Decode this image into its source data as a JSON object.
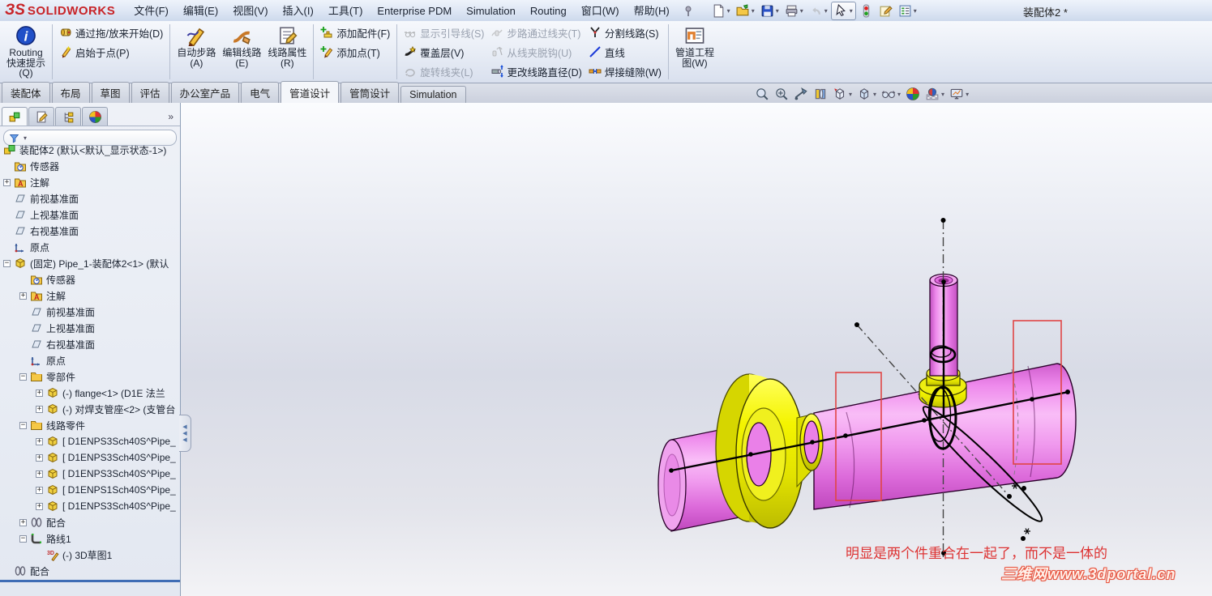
{
  "window": {
    "doc_title": "装配体2 *"
  },
  "logo": {
    "mark": "ЗS",
    "name": "SOLIDWORKS"
  },
  "menus": [
    "文件(F)",
    "编辑(E)",
    "视图(V)",
    "插入(I)",
    "工具(T)",
    "Enterprise PDM",
    "Simulation",
    "Routing",
    "窗口(W)",
    "帮助(H)"
  ],
  "quickbar": [
    {
      "icon": "new-document",
      "dropdown": true
    },
    {
      "icon": "open",
      "dropdown": true
    },
    {
      "icon": "save",
      "dropdown": true
    },
    {
      "icon": "print",
      "dropdown": true
    },
    {
      "icon": "undo",
      "dropdown": true,
      "disabled": true
    },
    {
      "icon": "select",
      "dropdown": true,
      "boxed": true
    },
    {
      "icon": "traffic-light",
      "dropdown": false
    },
    {
      "icon": "edit-properties",
      "dropdown": false
    },
    {
      "icon": "task-list",
      "dropdown": true
    }
  ],
  "ribbon": {
    "groups": [
      {
        "type": "big",
        "items": [
          {
            "label": "Routing 快速提示(Q)",
            "icon": "info"
          }
        ]
      },
      {
        "type": "stack",
        "items": [
          {
            "label": "通过拖/放来开始(D)",
            "icon": "drag-start"
          },
          {
            "label": "启始于点(P)",
            "icon": "start-point"
          }
        ]
      },
      {
        "type": "big",
        "items": [
          {
            "label": "自动步路(A)",
            "icon": "auto-route"
          },
          {
            "label": "编辑线路(E)",
            "icon": "edit-route"
          },
          {
            "label": "线路属性(R)",
            "icon": "route-properties"
          }
        ]
      },
      {
        "type": "stack",
        "items": [
          {
            "label": "添加配件(F)",
            "icon": "add-fitting"
          },
          {
            "label": "添加点(T)",
            "icon": "add-point"
          }
        ]
      },
      {
        "type": "cols",
        "cols": [
          [
            {
              "label": "显示引导线(S)",
              "icon": "show-guides",
              "disabled": true
            },
            {
              "label": "覆盖层(V)",
              "icon": "cover"
            },
            {
              "label": "旋转线夹(L)",
              "icon": "rotate-clip",
              "disabled": true
            }
          ],
          [
            {
              "label": "步路通过线夹(T)",
              "icon": "route-through-clip",
              "disabled": true
            },
            {
              "label": "从线夹脱钩(U)",
              "icon": "unhook-clip",
              "disabled": true
            },
            {
              "label": "更改线路直径(D)",
              "icon": "change-diameter"
            }
          ],
          [
            {
              "label": "分割线路(S)",
              "icon": "split-route"
            },
            {
              "label": "直线",
              "icon": "straight-line"
            },
            {
              "label": "焊接缝隙(W)",
              "icon": "weld-gap"
            }
          ]
        ]
      },
      {
        "type": "big",
        "items": [
          {
            "label": "管道工程图(W)",
            "icon": "pipe-drawing"
          }
        ]
      }
    ]
  },
  "command_tabs": [
    {
      "label": "装配体"
    },
    {
      "label": "布局"
    },
    {
      "label": "草图"
    },
    {
      "label": "评估"
    },
    {
      "label": "办公室产品"
    },
    {
      "label": "电气"
    },
    {
      "label": "管道设计",
      "active": true
    },
    {
      "label": "管筒设计"
    },
    {
      "label": "Simulation"
    }
  ],
  "panel": {
    "tabs": [
      {
        "icon": "feature-manager",
        "active": true
      },
      {
        "icon": "property-manager"
      },
      {
        "icon": "configuration-manager"
      },
      {
        "icon": "display-manager"
      }
    ],
    "overflow": "»",
    "tree": [
      {
        "label": "装配体2 (默认<默认_显示状态-1>)",
        "icon": "assembly",
        "level": 0,
        "expand": "none"
      },
      {
        "label": "传感器",
        "icon": "sensor",
        "level": 1,
        "expand": "none"
      },
      {
        "label": "注解",
        "icon": "annotation",
        "level": 1,
        "expand": "plus"
      },
      {
        "label": "前视基准面",
        "icon": "plane",
        "level": 1,
        "expand": "none"
      },
      {
        "label": "上视基准面",
        "icon": "plane",
        "level": 1,
        "expand": "none"
      },
      {
        "label": "右视基准面",
        "icon": "plane",
        "level": 1,
        "expand": "none"
      },
      {
        "label": "原点",
        "icon": "origin",
        "level": 1,
        "expand": "none"
      },
      {
        "label": "(固定) Pipe_1-装配体2<1> (默认",
        "icon": "part",
        "level": 1,
        "expand": "minus"
      },
      {
        "label": "传感器",
        "icon": "sensor",
        "level": 2,
        "expand": "none"
      },
      {
        "label": "注解",
        "icon": "annotation",
        "level": 2,
        "expand": "plus"
      },
      {
        "label": "前视基准面",
        "icon": "plane",
        "level": 2,
        "expand": "none"
      },
      {
        "label": "上视基准面",
        "icon": "plane",
        "level": 2,
        "expand": "none"
      },
      {
        "label": "右视基准面",
        "icon": "plane",
        "level": 2,
        "expand": "none"
      },
      {
        "label": "原点",
        "icon": "origin",
        "level": 2,
        "expand": "none"
      },
      {
        "label": "零部件",
        "icon": "folder",
        "level": 2,
        "expand": "minus"
      },
      {
        "label": "(-) flange<1> (D1E 法兰",
        "icon": "part",
        "level": 3,
        "expand": "plus"
      },
      {
        "label": "(-) 对焊支管座<2> (支管台",
        "icon": "part",
        "level": 3,
        "expand": "plus"
      },
      {
        "label": "线路零件",
        "icon": "folder",
        "level": 2,
        "expand": "minus"
      },
      {
        "label": "[ D1ENPS3Sch40S^Pipe_",
        "icon": "part",
        "level": 3,
        "expand": "plus"
      },
      {
        "label": "[ D1ENPS3Sch40S^Pipe_",
        "icon": "part",
        "level": 3,
        "expand": "plus"
      },
      {
        "label": "[ D1ENPS3Sch40S^Pipe_",
        "icon": "part",
        "level": 3,
        "expand": "plus"
      },
      {
        "label": "[ D1ENPS1Sch40S^Pipe_",
        "icon": "part",
        "level": 3,
        "expand": "plus"
      },
      {
        "label": "[ D1ENPS3Sch40S^Pipe_",
        "icon": "part",
        "level": 3,
        "expand": "plus"
      },
      {
        "label": "配合",
        "icon": "mates",
        "level": 2,
        "expand": "plus"
      },
      {
        "label": "路线1",
        "icon": "route",
        "level": 2,
        "expand": "minus"
      },
      {
        "label": "(-) 3D草图1",
        "icon": "sketch3d",
        "level": 3,
        "expand": "none"
      },
      {
        "label": "配合",
        "icon": "mates",
        "level": 1,
        "expand": "none"
      }
    ]
  },
  "viewport": {
    "headsup": [
      {
        "icon": "zoom-to-fit",
        "dropdown": false
      },
      {
        "icon": "zoom-to-area",
        "dropdown": false
      },
      {
        "icon": "zoom-to-selection",
        "dropdown": false
      },
      {
        "icon": "section-view",
        "dropdown": false
      },
      {
        "icon": "view-orientation",
        "dropdown": true
      },
      {
        "icon": "display-style",
        "dropdown": true
      },
      {
        "icon": "hide-show-items",
        "dropdown": true
      },
      {
        "icon": "edit-appearance",
        "dropdown": false
      },
      {
        "icon": "apply-scene",
        "dropdown": true
      },
      {
        "icon": "view-settings",
        "dropdown": true
      }
    ],
    "annotation": "明显是两个件重合在一起了，而不是一体的",
    "watermark": "三维网www.3dportal.cn",
    "colors": {
      "pipe_pink": "#ee82ec",
      "fitting_yellow": "#eded00",
      "selection_red": "#e04545",
      "annotation_red": "#dd3333",
      "sketch_black": "#000000"
    }
  }
}
